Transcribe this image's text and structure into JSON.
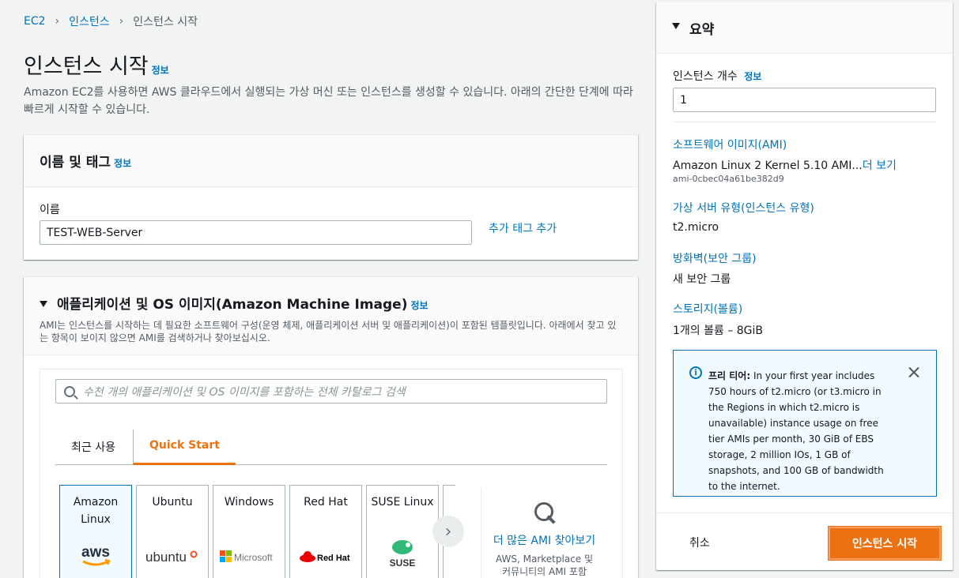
{
  "breadcrumb": {
    "items": [
      "EC2",
      "인스턴스",
      "인스턴스 시작"
    ]
  },
  "page": {
    "title": "인스턴스 시작",
    "info": "정보",
    "description": "Amazon EC2를 사용하면 AWS 클라우드에서 실행되는 가상 머신 또는 인스턴스를 생성할 수 있습니다. 아래의 간단한 단계에 따라 빠르게 시작할 수 있습니다."
  },
  "name_section": {
    "title": "이름 및 태그",
    "info": "정보",
    "name_label": "이름",
    "name_value": "TEST-WEB-Server",
    "add_tag": "추가 태그 추가"
  },
  "ami_section": {
    "title": "애플리케이션 및 OS 이미지(Amazon Machine Image)",
    "info": "정보",
    "description": "AMI는 인스턴스를 시작하는 데 필요한 소프트웨어 구성(운영 체제, 애플리케이션 서버 및 애플리케이션)이 포함된 템플릿입니다. 아래에서 찾고 있는 항목이 보이지 않으면 AMI를 검색하거나 찾아보십시오.",
    "search_placeholder": "수천 개의 애플리케이션 및 OS 이미지를 포함하는 전체 카탈로그 검색",
    "tabs": [
      {
        "label": "최근 사용",
        "active": false
      },
      {
        "label": "Quick Start",
        "active": true
      }
    ],
    "os_tiles": [
      {
        "label": "Amazon Linux",
        "logo": "aws",
        "selected": true
      },
      {
        "label": "Ubuntu",
        "logo": "ubuntu",
        "selected": false
      },
      {
        "label": "Windows",
        "logo": "Microsoft",
        "selected": false
      },
      {
        "label": "Red Hat",
        "logo": "Red Hat",
        "selected": false
      },
      {
        "label": "SUSE Linux",
        "logo": "SUSE",
        "selected": false
      }
    ],
    "more_ami": "더 많은 AMI 찾아보기",
    "more_ami_sub": "AWS, Marketplace 및 커뮤니티의 AMI 포함"
  },
  "summary": {
    "title": "요약",
    "count_label": "인스턴스 개수",
    "info": "정보",
    "count_value": "1",
    "ami_link": "소프트웨어 이미지(AMI)",
    "ami_value": "Amazon Linux 2 Kernel 5.10 AMI...",
    "ami_more": "더 보기",
    "ami_id": "ami-0cbec04a61be382d9",
    "instance_type_link": "가상 서버 유형(인스턴스 유형)",
    "instance_type_value": "t2.micro",
    "firewall_link": "방화벽(보안 그룹)",
    "firewall_value": "새 보안 그룹",
    "storage_link": "스토리지(볼륨)",
    "storage_value": "1개의 볼륨 – 8GiB",
    "free_tier_title": "프리 티어:",
    "free_tier_text": "In your first year includes 750 hours of t2.micro (or t3.micro in the Regions in which t2.micro is unavailable) instance usage on free tier AMIs per month, 30 GiB of EBS storage, 2 million IOs, 1 GB of snapshots, and 100 GB of bandwidth to the internet.",
    "cancel": "취소",
    "launch": "인스턴스 시작"
  },
  "colors": {
    "accent": "#ec7211",
    "link": "#0073bb",
    "info_bg": "#f1faff"
  }
}
